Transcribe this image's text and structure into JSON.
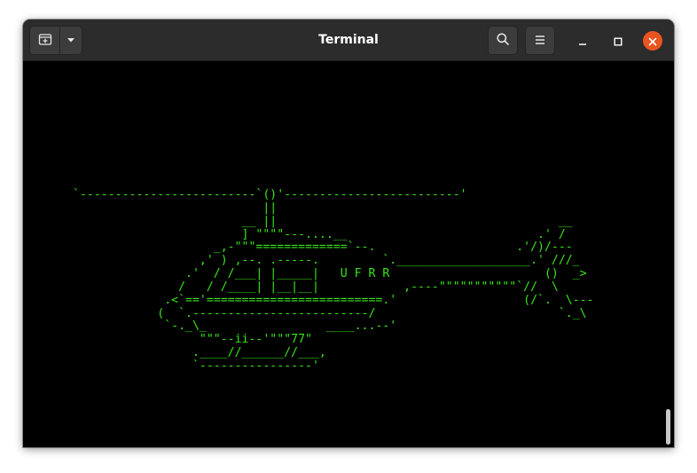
{
  "window": {
    "title": "Terminal"
  },
  "icons": {
    "new_tab": "new-tab-icon",
    "dropdown": "chevron-down-icon",
    "search": "search-icon",
    "menu": "hamburger-menu-icon",
    "minimize": "minimize-icon",
    "maximize": "maximize-icon",
    "close": "close-icon"
  },
  "colors": {
    "headerbar": "#2c2c2c",
    "terminal_bg": "#000000",
    "terminal_fg": "#39e619",
    "close_accent": "#e95420"
  },
  "terminal": {
    "lines": [
      "`-------------------------`()'-------------------------'",
      "                           ||",
      "                        __ ||                                        __",
      "                        ] \"\"\"\"---....__                           .' /",
      "                    _,-\"\"\"=============`--.                    .'/)/---",
      "                  ,' ) ,--. .-----.         `.___________________.' ///_",
      "                .'  / /___| |_____|   U F R R                      ()  _>",
      "               /   / /____| |__|__|            ,----\"\"\"\"\"\"\"\"\"\"\"`//  \\",
      "             .<`=='=========================.'                  (/`.  \\---",
      "            (  `.-------------------------/                          `._\\",
      "             `-._\\_                 ____...--'",
      "                  \"\"\"--ii--'\"\"\"77\"",
      "                 .____//______//___,",
      "                 `----------------'"
    ]
  }
}
